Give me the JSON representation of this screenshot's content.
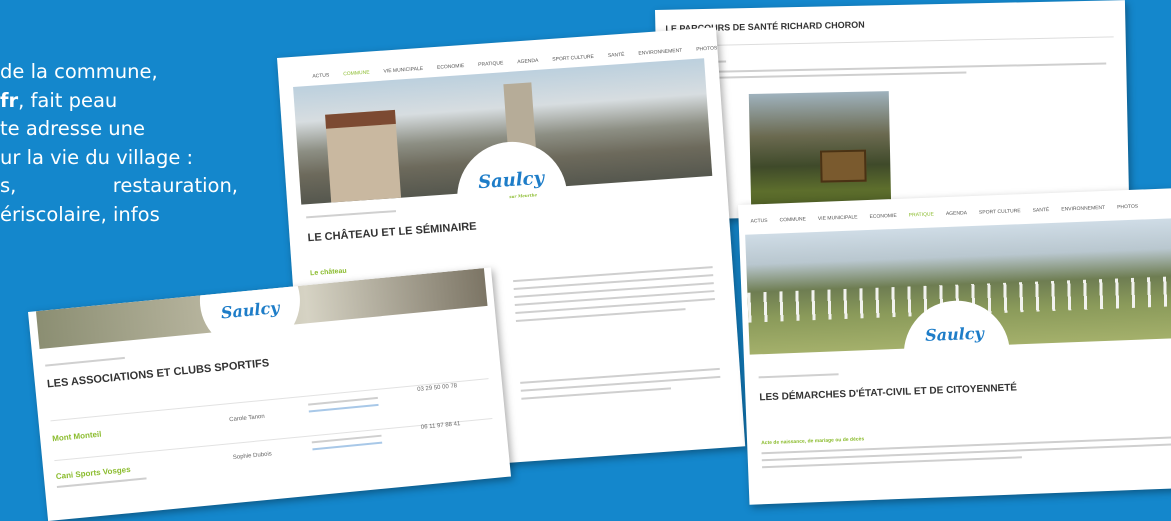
{
  "intro": {
    "line1": "de la commune,",
    "line2_bold": "fr",
    "line2_rest": ", fait peau",
    "line3": "te adresse une",
    "line4": "ur la vie du village :",
    "line5a": "s,",
    "line5b": "restauration,",
    "line6": "ériscolaire, infos"
  },
  "site": {
    "logo": "Saulcy",
    "logo_sub": "sur Meurthe"
  },
  "card_parcours": {
    "title": "LE PARCOURS DE SANTÉ RICHARD CHORON"
  },
  "card_chateau": {
    "title": "LE CHÂTEAU ET LE SÉMINAIRE",
    "subtitle": "Le château",
    "nav": [
      "ACTUS",
      "COMMUNE",
      "VIE MUNICIPALE",
      "ECONOMIE",
      "PRATIQUE",
      "AGENDA",
      "SPORT CULTURE",
      "SANTÉ",
      "ENVIRONNEMENT",
      "PHOTOS"
    ],
    "active_nav_index": 1
  },
  "card_demarches": {
    "title": "LES DÉMARCHES D'ÉTAT-CIVIL ET DE CITOYENNETÉ",
    "subtitle": "Acte de naissance, de mariage ou de décès",
    "nav": [
      "ACTUS",
      "COMMUNE",
      "VIE MUNICIPALE",
      "ECONOMIE",
      "PRATIQUE",
      "AGENDA",
      "SPORT CULTURE",
      "SANTÉ",
      "ENVIRONNEMENT",
      "PHOTOS"
    ],
    "active_nav_index": 4
  },
  "card_associations": {
    "title": "LES ASSOCIATIONS ET CLUBS SPORTIFS",
    "rows": [
      {
        "name": "Mont Monteil",
        "contact": "Carole Tanon",
        "phone": "03 29 50 00 78"
      },
      {
        "name": "Cani Sports Vosges",
        "contact": "Sophie Dubois",
        "phone": "06 11 97 88 41"
      }
    ]
  }
}
